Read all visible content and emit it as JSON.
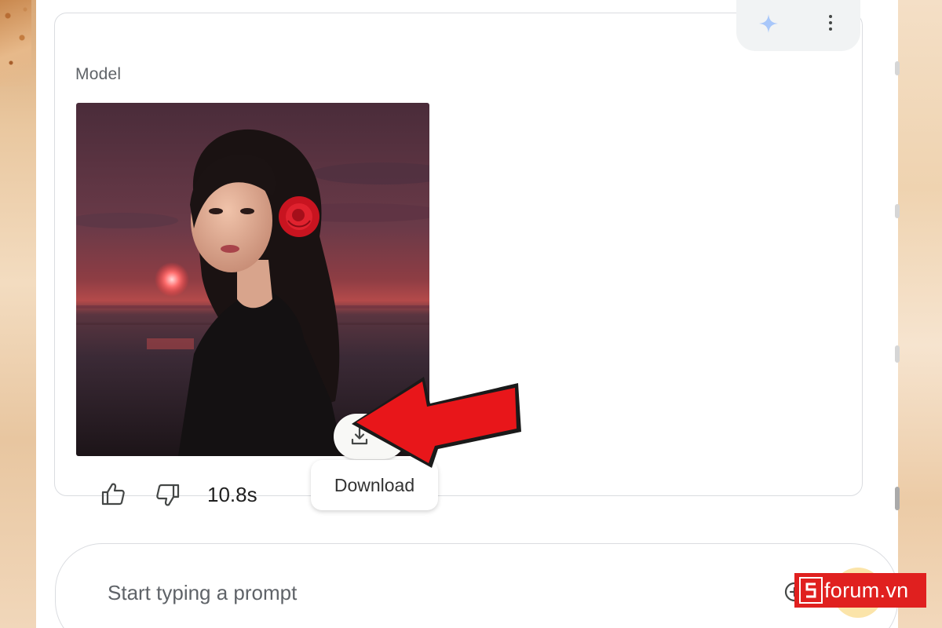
{
  "card": {
    "role_label": "Model",
    "image_alt": "Generated portrait at sunset beach"
  },
  "actions": {
    "download_tooltip": "Download"
  },
  "feedback": {
    "response_time": "10.8s"
  },
  "prompt": {
    "placeholder": "Start typing a prompt"
  },
  "watermark": {
    "text": "forum.vn",
    "logo_letter": "S"
  },
  "colors": {
    "accent_spark": "#8ab4f8",
    "watermark_red": "#e0201f",
    "arrow_red": "#e8161a"
  },
  "icons": [
    "spark-icon",
    "more-vert-icon",
    "download-icon",
    "thumbs-up-icon",
    "thumbs-down-icon",
    "add-circle-icon"
  ]
}
